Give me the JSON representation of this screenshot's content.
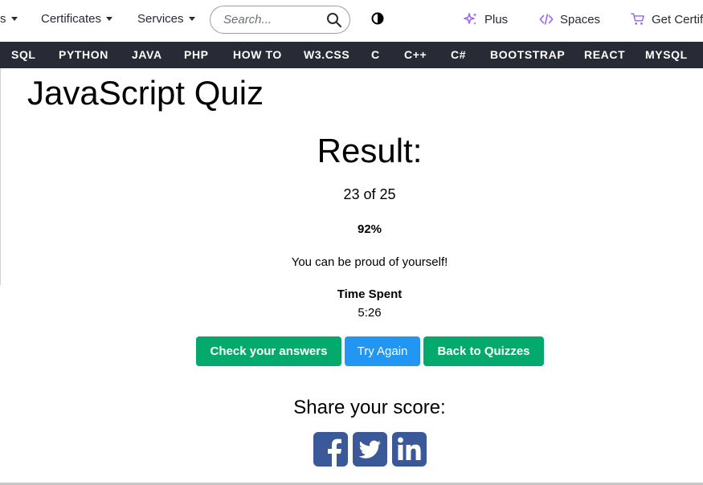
{
  "topnav": {
    "partial_item_label": "s",
    "certificates_label": "Certificates",
    "services_label": "Services",
    "search_placeholder": "Search...",
    "plus_label": "Plus",
    "spaces_label": "Spaces",
    "get_cert_label": "Get Certif"
  },
  "menu": [
    "SQL",
    "PYTHON",
    "JAVA",
    "PHP",
    "HOW TO",
    "W3.CSS",
    "C",
    "C++",
    "C#",
    "BOOTSTRAP",
    "REACT",
    "MYSQL"
  ],
  "page": {
    "title": "JavaScript Quiz"
  },
  "result": {
    "heading": "Result:",
    "score_text": "23 of 25",
    "percent_text": "92%",
    "message": "You can be proud of yourself!",
    "time_label": "Time Spent",
    "time_value": "5:26"
  },
  "buttons": {
    "check_answers": "Check your answers",
    "try_again": "Try Again",
    "back_to_quizzes": "Back to Quizzes"
  },
  "share": {
    "heading": "Share your score:",
    "icons": [
      "facebook-icon",
      "twitter-icon",
      "linkedin-icon"
    ]
  },
  "colors": {
    "dark_nav": "#282a35",
    "green": "#04aa6d",
    "blue": "#2196f3",
    "purple_accent": "#9763f6",
    "social_blue": "#3b5998"
  }
}
